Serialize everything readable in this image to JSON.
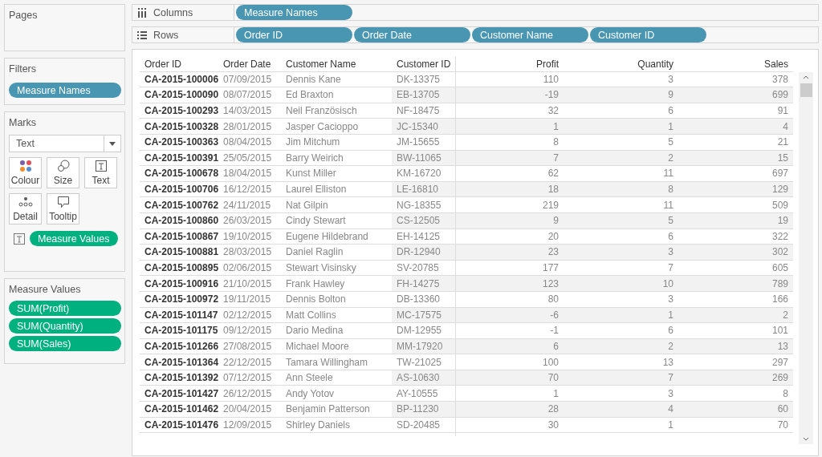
{
  "pages": {
    "title": "Pages"
  },
  "filters": {
    "title": "Filters",
    "pills": [
      {
        "label": "Measure Names",
        "kind": "dimension"
      }
    ]
  },
  "marks": {
    "title": "Marks",
    "mark_type": "Text",
    "cards": [
      {
        "label": "Colour",
        "kind": "colour"
      },
      {
        "label": "Size",
        "kind": "size"
      },
      {
        "label": "Text",
        "kind": "text"
      },
      {
        "label": "Detail",
        "kind": "detail"
      },
      {
        "label": "Tooltip",
        "kind": "tooltip"
      }
    ],
    "fields": [
      {
        "label": "Measure Values",
        "kind": "measure"
      }
    ]
  },
  "measure_values": {
    "title": "Measure Values",
    "pills": [
      {
        "label": "SUM(Profit)",
        "kind": "measure"
      },
      {
        "label": "SUM(Quantity)",
        "kind": "measure"
      },
      {
        "label": "SUM(Sales)",
        "kind": "measure"
      }
    ]
  },
  "columns_shelf": {
    "label": "Columns",
    "pills": [
      {
        "label": "Measure Names",
        "kind": "dimension"
      }
    ]
  },
  "rows_shelf": {
    "label": "Rows",
    "pills": [
      {
        "label": "Order ID",
        "kind": "dimension"
      },
      {
        "label": "Order Date",
        "kind": "dimension"
      },
      {
        "label": "Customer Name",
        "kind": "dimension"
      },
      {
        "label": "Customer ID",
        "kind": "dimension"
      }
    ]
  },
  "table": {
    "columns": [
      {
        "label": "Order ID",
        "kind": "id"
      },
      {
        "label": "Order Date",
        "kind": "text"
      },
      {
        "label": "Customer Name",
        "kind": "text"
      },
      {
        "label": "Customer ID",
        "kind": "text"
      },
      {
        "label": "Profit",
        "kind": "number"
      },
      {
        "label": "Quantity",
        "kind": "number"
      },
      {
        "label": "Sales",
        "kind": "number"
      }
    ],
    "rows": [
      [
        "CA-2015-100006",
        "07/09/2015",
        "Dennis Kane",
        "DK-13375",
        "110",
        "3",
        "378"
      ],
      [
        "CA-2015-100090",
        "08/07/2015",
        "Ed Braxton",
        "EB-13705",
        "-19",
        "9",
        "699"
      ],
      [
        "CA-2015-100293",
        "14/03/2015",
        "Neil Französisch",
        "NF-18475",
        "32",
        "6",
        "91"
      ],
      [
        "CA-2015-100328",
        "28/01/2015",
        "Jasper Cacioppo",
        "JC-15340",
        "1",
        "1",
        "4"
      ],
      [
        "CA-2015-100363",
        "08/04/2015",
        "Jim Mitchum",
        "JM-15655",
        "8",
        "5",
        "21"
      ],
      [
        "CA-2015-100391",
        "25/05/2015",
        "Barry Weirich",
        "BW-11065",
        "7",
        "2",
        "15"
      ],
      [
        "CA-2015-100678",
        "18/04/2015",
        "Kunst Miller",
        "KM-16720",
        "62",
        "11",
        "697"
      ],
      [
        "CA-2015-100706",
        "16/12/2015",
        "Laurel Elliston",
        "LE-16810",
        "18",
        "8",
        "129"
      ],
      [
        "CA-2015-100762",
        "24/11/2015",
        "Nat Gilpin",
        "NG-18355",
        "219",
        "11",
        "509"
      ],
      [
        "CA-2015-100860",
        "26/03/2015",
        "Cindy Stewart",
        "CS-12505",
        "9",
        "5",
        "19"
      ],
      [
        "CA-2015-100867",
        "19/10/2015",
        "Eugene Hildebrand",
        "EH-14125",
        "20",
        "6",
        "322"
      ],
      [
        "CA-2015-100881",
        "28/03/2015",
        "Daniel Raglin",
        "DR-12940",
        "23",
        "3",
        "302"
      ],
      [
        "CA-2015-100895",
        "02/06/2015",
        "Stewart Visinsky",
        "SV-20785",
        "177",
        "7",
        "605"
      ],
      [
        "CA-2015-100916",
        "21/10/2015",
        "Frank Hawley",
        "FH-14275",
        "123",
        "10",
        "789"
      ],
      [
        "CA-2015-100972",
        "19/11/2015",
        "Dennis Bolton",
        "DB-13360",
        "80",
        "3",
        "166"
      ],
      [
        "CA-2015-101147",
        "02/12/2015",
        "Matt Collins",
        "MC-17575",
        "-6",
        "1",
        "2"
      ],
      [
        "CA-2015-101175",
        "09/12/2015",
        "Dario Medina",
        "DM-12955",
        "-1",
        "6",
        "101"
      ],
      [
        "CA-2015-101266",
        "27/08/2015",
        "Michael Moore",
        "MM-17920",
        "6",
        "2",
        "13"
      ],
      [
        "CA-2015-101364",
        "22/12/2015",
        "Tamara Willingham",
        "TW-21025",
        "100",
        "13",
        "297"
      ],
      [
        "CA-2015-101392",
        "07/12/2015",
        "Ann Steele",
        "AS-10630",
        "70",
        "7",
        "269"
      ],
      [
        "CA-2015-101427",
        "26/12/2015",
        "Andy Yotov",
        "AY-10555",
        "1",
        "3",
        "8"
      ],
      [
        "CA-2015-101462",
        "20/04/2015",
        "Benjamin Patterson",
        "BP-11230",
        "28",
        "4",
        "60"
      ],
      [
        "CA-2015-101476",
        "12/09/2015",
        "Shirley Daniels",
        "SD-20485",
        "30",
        "1",
        "70"
      ]
    ]
  }
}
